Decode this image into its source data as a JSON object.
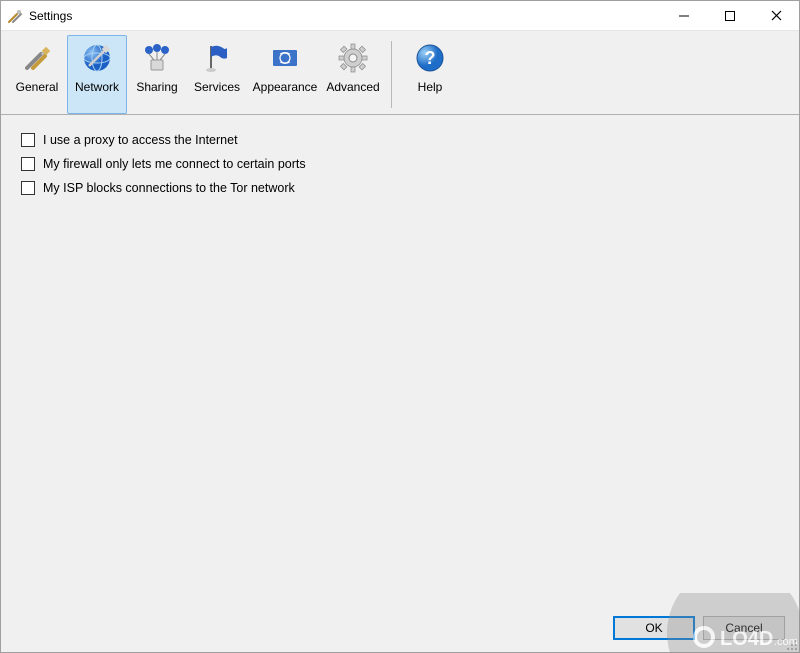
{
  "window": {
    "title": "Settings"
  },
  "toolbar": {
    "items": [
      {
        "label": "General",
        "icon": "tools-icon"
      },
      {
        "label": "Network",
        "icon": "globe-icon",
        "selected": true
      },
      {
        "label": "Sharing",
        "icon": "network-nodes-icon"
      },
      {
        "label": "Services",
        "icon": "flag-icon"
      },
      {
        "label": "Appearance",
        "icon": "un-flag-icon"
      },
      {
        "label": "Advanced",
        "icon": "gear-icon"
      },
      {
        "label": "Help",
        "icon": "help-icon"
      }
    ]
  },
  "content": {
    "checkboxes": [
      {
        "label": "I use a proxy to access the Internet",
        "checked": false
      },
      {
        "label": "My firewall only lets me connect to certain ports",
        "checked": false
      },
      {
        "label": "My ISP blocks connections to the Tor network",
        "checked": false
      }
    ]
  },
  "buttons": {
    "ok": "OK",
    "cancel": "Cancel"
  },
  "watermark": "LO4D.com"
}
